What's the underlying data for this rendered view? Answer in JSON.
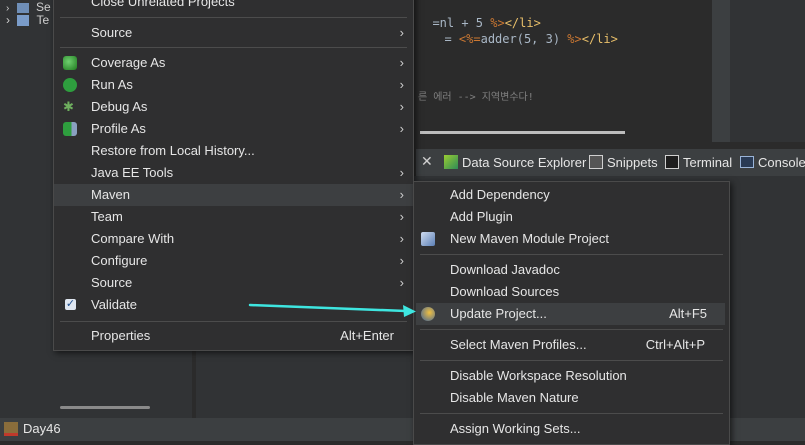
{
  "project_tree": {
    "rows": [
      {
        "label": "Se"
      },
      {
        "label": "Te"
      }
    ]
  },
  "editor": {
    "line1_a": "=nl + 5 ",
    "line1_b": "%>",
    "line1_c": "</li>",
    "line2_a": "= ",
    "line2_b": "<%=",
    "line2_c": "adder(5, 3) ",
    "line2_d": "%>",
    "line2_e": "</li>",
    "comment": "른 에러 --> 지역변수다!"
  },
  "view_tabs": [
    {
      "label": "Data Source Explorer",
      "icon": "data-source-explorer-icon"
    },
    {
      "label": "Snippets",
      "icon": "snippets-icon"
    },
    {
      "label": "Terminal",
      "icon": "terminal-icon"
    },
    {
      "label": "Console",
      "icon": "console-icon"
    }
  ],
  "context_menu": {
    "items": [
      {
        "label": "Close Unrelated Projects"
      },
      {
        "label": "Source",
        "submenu": true
      },
      {
        "label": "Coverage As",
        "submenu": true,
        "icon": "coverage-icon"
      },
      {
        "label": "Run As",
        "submenu": true,
        "icon": "run-icon"
      },
      {
        "label": "Debug As",
        "submenu": true,
        "icon": "debug-icon"
      },
      {
        "label": "Profile As",
        "submenu": true,
        "icon": "profile-icon"
      },
      {
        "label": "Restore from Local History..."
      },
      {
        "label": "Java EE Tools",
        "submenu": true
      },
      {
        "label": "Maven",
        "submenu": true,
        "selected": true
      },
      {
        "label": "Team",
        "submenu": true
      },
      {
        "label": "Compare With",
        "submenu": true
      },
      {
        "label": "Configure",
        "submenu": true
      },
      {
        "label": "Source",
        "submenu": true
      },
      {
        "label": "Validate",
        "icon": "checkmark-icon"
      },
      {
        "label": "Properties",
        "accelerator": "Alt+Enter"
      }
    ]
  },
  "maven_submenu": {
    "items": [
      {
        "label": "Add Dependency"
      },
      {
        "label": "Add Plugin"
      },
      {
        "label": "New Maven Module Project",
        "icon": "maven-module-icon"
      },
      {
        "label": "Download Javadoc"
      },
      {
        "label": "Download Sources"
      },
      {
        "label": "Update Project...",
        "accelerator": "Alt+F5",
        "icon": "update-project-icon",
        "highlighted": true
      },
      {
        "label": "Select Maven Profiles...",
        "accelerator": "Ctrl+Alt+P"
      },
      {
        "label": "Disable Workspace Resolution"
      },
      {
        "label": "Disable Maven Nature"
      },
      {
        "label": "Assign Working Sets..."
      }
    ]
  },
  "status_bar": {
    "project": "Day46"
  },
  "colors": {
    "annotation_arrow": "#3ee6e0",
    "menu_bg": "#2f2f30",
    "menu_highlight": "#3d3f41"
  }
}
